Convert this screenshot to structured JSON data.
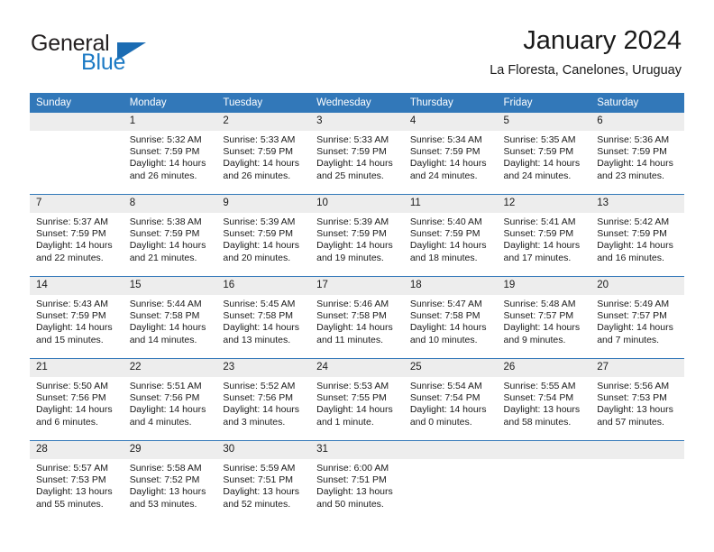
{
  "brand": {
    "name_part1": "General",
    "name_part2": "Blue",
    "triangle_color": "#1b6cb3",
    "blue_text_color": "#1b79c4"
  },
  "header": {
    "title": "January 2024",
    "subtitle": "La Floresta, Canelones, Uruguay"
  },
  "theme": {
    "header_row_bg": "#3278b9",
    "header_row_text": "#ffffff",
    "daynum_bg": "#ededed",
    "row_divider": "#3278b9"
  },
  "weekdays": [
    "Sunday",
    "Monday",
    "Tuesday",
    "Wednesday",
    "Thursday",
    "Friday",
    "Saturday"
  ],
  "weeks": [
    [
      {
        "day": "",
        "sunrise": "",
        "sunset": "",
        "daylight_line1": "",
        "daylight_line2": ""
      },
      {
        "day": "1",
        "sunrise": "Sunrise: 5:32 AM",
        "sunset": "Sunset: 7:59 PM",
        "daylight_line1": "Daylight: 14 hours",
        "daylight_line2": "and 26 minutes."
      },
      {
        "day": "2",
        "sunrise": "Sunrise: 5:33 AM",
        "sunset": "Sunset: 7:59 PM",
        "daylight_line1": "Daylight: 14 hours",
        "daylight_line2": "and 26 minutes."
      },
      {
        "day": "3",
        "sunrise": "Sunrise: 5:33 AM",
        "sunset": "Sunset: 7:59 PM",
        "daylight_line1": "Daylight: 14 hours",
        "daylight_line2": "and 25 minutes."
      },
      {
        "day": "4",
        "sunrise": "Sunrise: 5:34 AM",
        "sunset": "Sunset: 7:59 PM",
        "daylight_line1": "Daylight: 14 hours",
        "daylight_line2": "and 24 minutes."
      },
      {
        "day": "5",
        "sunrise": "Sunrise: 5:35 AM",
        "sunset": "Sunset: 7:59 PM",
        "daylight_line1": "Daylight: 14 hours",
        "daylight_line2": "and 24 minutes."
      },
      {
        "day": "6",
        "sunrise": "Sunrise: 5:36 AM",
        "sunset": "Sunset: 7:59 PM",
        "daylight_line1": "Daylight: 14 hours",
        "daylight_line2": "and 23 minutes."
      }
    ],
    [
      {
        "day": "7",
        "sunrise": "Sunrise: 5:37 AM",
        "sunset": "Sunset: 7:59 PM",
        "daylight_line1": "Daylight: 14 hours",
        "daylight_line2": "and 22 minutes."
      },
      {
        "day": "8",
        "sunrise": "Sunrise: 5:38 AM",
        "sunset": "Sunset: 7:59 PM",
        "daylight_line1": "Daylight: 14 hours",
        "daylight_line2": "and 21 minutes."
      },
      {
        "day": "9",
        "sunrise": "Sunrise: 5:39 AM",
        "sunset": "Sunset: 7:59 PM",
        "daylight_line1": "Daylight: 14 hours",
        "daylight_line2": "and 20 minutes."
      },
      {
        "day": "10",
        "sunrise": "Sunrise: 5:39 AM",
        "sunset": "Sunset: 7:59 PM",
        "daylight_line1": "Daylight: 14 hours",
        "daylight_line2": "and 19 minutes."
      },
      {
        "day": "11",
        "sunrise": "Sunrise: 5:40 AM",
        "sunset": "Sunset: 7:59 PM",
        "daylight_line1": "Daylight: 14 hours",
        "daylight_line2": "and 18 minutes."
      },
      {
        "day": "12",
        "sunrise": "Sunrise: 5:41 AM",
        "sunset": "Sunset: 7:59 PM",
        "daylight_line1": "Daylight: 14 hours",
        "daylight_line2": "and 17 minutes."
      },
      {
        "day": "13",
        "sunrise": "Sunrise: 5:42 AM",
        "sunset": "Sunset: 7:59 PM",
        "daylight_line1": "Daylight: 14 hours",
        "daylight_line2": "and 16 minutes."
      }
    ],
    [
      {
        "day": "14",
        "sunrise": "Sunrise: 5:43 AM",
        "sunset": "Sunset: 7:59 PM",
        "daylight_line1": "Daylight: 14 hours",
        "daylight_line2": "and 15 minutes."
      },
      {
        "day": "15",
        "sunrise": "Sunrise: 5:44 AM",
        "sunset": "Sunset: 7:58 PM",
        "daylight_line1": "Daylight: 14 hours",
        "daylight_line2": "and 14 minutes."
      },
      {
        "day": "16",
        "sunrise": "Sunrise: 5:45 AM",
        "sunset": "Sunset: 7:58 PM",
        "daylight_line1": "Daylight: 14 hours",
        "daylight_line2": "and 13 minutes."
      },
      {
        "day": "17",
        "sunrise": "Sunrise: 5:46 AM",
        "sunset": "Sunset: 7:58 PM",
        "daylight_line1": "Daylight: 14 hours",
        "daylight_line2": "and 11 minutes."
      },
      {
        "day": "18",
        "sunrise": "Sunrise: 5:47 AM",
        "sunset": "Sunset: 7:58 PM",
        "daylight_line1": "Daylight: 14 hours",
        "daylight_line2": "and 10 minutes."
      },
      {
        "day": "19",
        "sunrise": "Sunrise: 5:48 AM",
        "sunset": "Sunset: 7:57 PM",
        "daylight_line1": "Daylight: 14 hours",
        "daylight_line2": "and 9 minutes."
      },
      {
        "day": "20",
        "sunrise": "Sunrise: 5:49 AM",
        "sunset": "Sunset: 7:57 PM",
        "daylight_line1": "Daylight: 14 hours",
        "daylight_line2": "and 7 minutes."
      }
    ],
    [
      {
        "day": "21",
        "sunrise": "Sunrise: 5:50 AM",
        "sunset": "Sunset: 7:56 PM",
        "daylight_line1": "Daylight: 14 hours",
        "daylight_line2": "and 6 minutes."
      },
      {
        "day": "22",
        "sunrise": "Sunrise: 5:51 AM",
        "sunset": "Sunset: 7:56 PM",
        "daylight_line1": "Daylight: 14 hours",
        "daylight_line2": "and 4 minutes."
      },
      {
        "day": "23",
        "sunrise": "Sunrise: 5:52 AM",
        "sunset": "Sunset: 7:56 PM",
        "daylight_line1": "Daylight: 14 hours",
        "daylight_line2": "and 3 minutes."
      },
      {
        "day": "24",
        "sunrise": "Sunrise: 5:53 AM",
        "sunset": "Sunset: 7:55 PM",
        "daylight_line1": "Daylight: 14 hours",
        "daylight_line2": "and 1 minute."
      },
      {
        "day": "25",
        "sunrise": "Sunrise: 5:54 AM",
        "sunset": "Sunset: 7:54 PM",
        "daylight_line1": "Daylight: 14 hours",
        "daylight_line2": "and 0 minutes."
      },
      {
        "day": "26",
        "sunrise": "Sunrise: 5:55 AM",
        "sunset": "Sunset: 7:54 PM",
        "daylight_line1": "Daylight: 13 hours",
        "daylight_line2": "and 58 minutes."
      },
      {
        "day": "27",
        "sunrise": "Sunrise: 5:56 AM",
        "sunset": "Sunset: 7:53 PM",
        "daylight_line1": "Daylight: 13 hours",
        "daylight_line2": "and 57 minutes."
      }
    ],
    [
      {
        "day": "28",
        "sunrise": "Sunrise: 5:57 AM",
        "sunset": "Sunset: 7:53 PM",
        "daylight_line1": "Daylight: 13 hours",
        "daylight_line2": "and 55 minutes."
      },
      {
        "day": "29",
        "sunrise": "Sunrise: 5:58 AM",
        "sunset": "Sunset: 7:52 PM",
        "daylight_line1": "Daylight: 13 hours",
        "daylight_line2": "and 53 minutes."
      },
      {
        "day": "30",
        "sunrise": "Sunrise: 5:59 AM",
        "sunset": "Sunset: 7:51 PM",
        "daylight_line1": "Daylight: 13 hours",
        "daylight_line2": "and 52 minutes."
      },
      {
        "day": "31",
        "sunrise": "Sunrise: 6:00 AM",
        "sunset": "Sunset: 7:51 PM",
        "daylight_line1": "Daylight: 13 hours",
        "daylight_line2": "and 50 minutes."
      },
      {
        "day": "",
        "sunrise": "",
        "sunset": "",
        "daylight_line1": "",
        "daylight_line2": ""
      },
      {
        "day": "",
        "sunrise": "",
        "sunset": "",
        "daylight_line1": "",
        "daylight_line2": ""
      },
      {
        "day": "",
        "sunrise": "",
        "sunset": "",
        "daylight_line1": "",
        "daylight_line2": ""
      }
    ]
  ]
}
